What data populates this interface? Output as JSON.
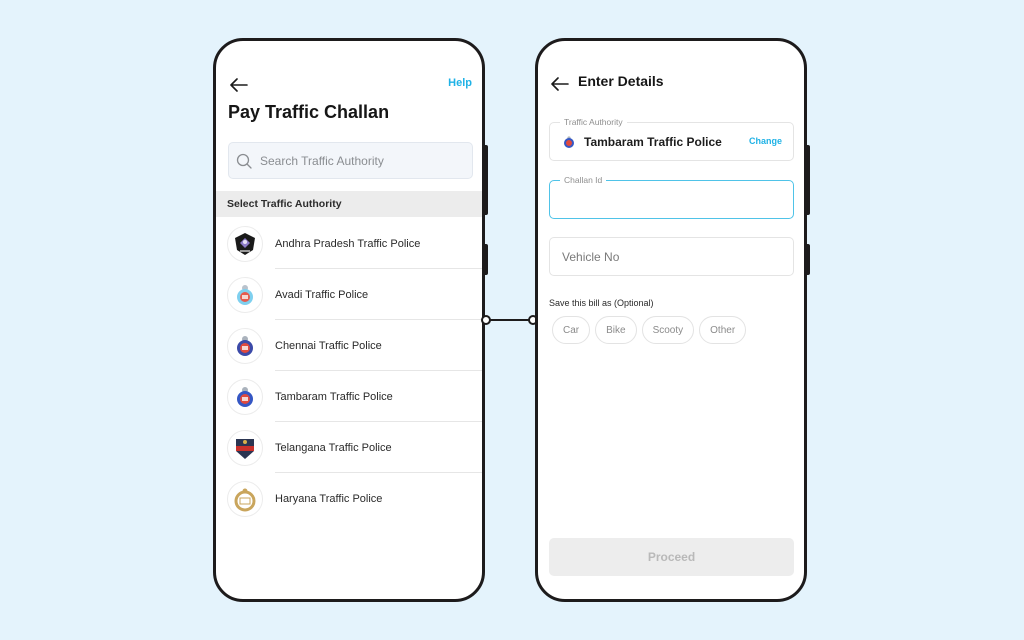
{
  "left_screen": {
    "help_label": "Help",
    "title": "Pay Traffic Challan",
    "search": {
      "placeholder": "Search Traffic Authority",
      "value": "",
      "icon": "search-icon"
    },
    "section_header": "Select Traffic Authority",
    "authorities": [
      {
        "label": "Andhra Pradesh Traffic Police",
        "icon": "andhra-pradesh-police-emblem-icon"
      },
      {
        "label": "Avadi Traffic Police",
        "icon": "avadi-police-emblem-icon"
      },
      {
        "label": "Chennai Traffic Police",
        "icon": "chennai-police-emblem-icon"
      },
      {
        "label": "Tambaram Traffic Police",
        "icon": "tambaram-police-emblem-icon"
      },
      {
        "label": "Telangana Traffic Police",
        "icon": "telangana-police-emblem-icon"
      },
      {
        "label": "Haryana Traffic Police",
        "icon": "haryana-police-emblem-icon"
      }
    ]
  },
  "right_screen": {
    "title": "Enter Details",
    "traffic_authority": {
      "legend": "Traffic Authority",
      "value": "Tambaram Traffic Police",
      "change_label": "Change"
    },
    "challan_id": {
      "legend": "Challan Id",
      "value": ""
    },
    "vehicle_no": {
      "placeholder": "Vehicle No",
      "value": ""
    },
    "save_label": "Save this bill as (Optional)",
    "save_options": [
      "Car",
      "Bike",
      "Scooty",
      "Other"
    ],
    "proceed_label": "Proceed"
  },
  "colors": {
    "background": "#e4f3fc",
    "accent": "#1fb2e6",
    "focus_border": "#4fc3e8",
    "disabled_button": "#ededed"
  }
}
